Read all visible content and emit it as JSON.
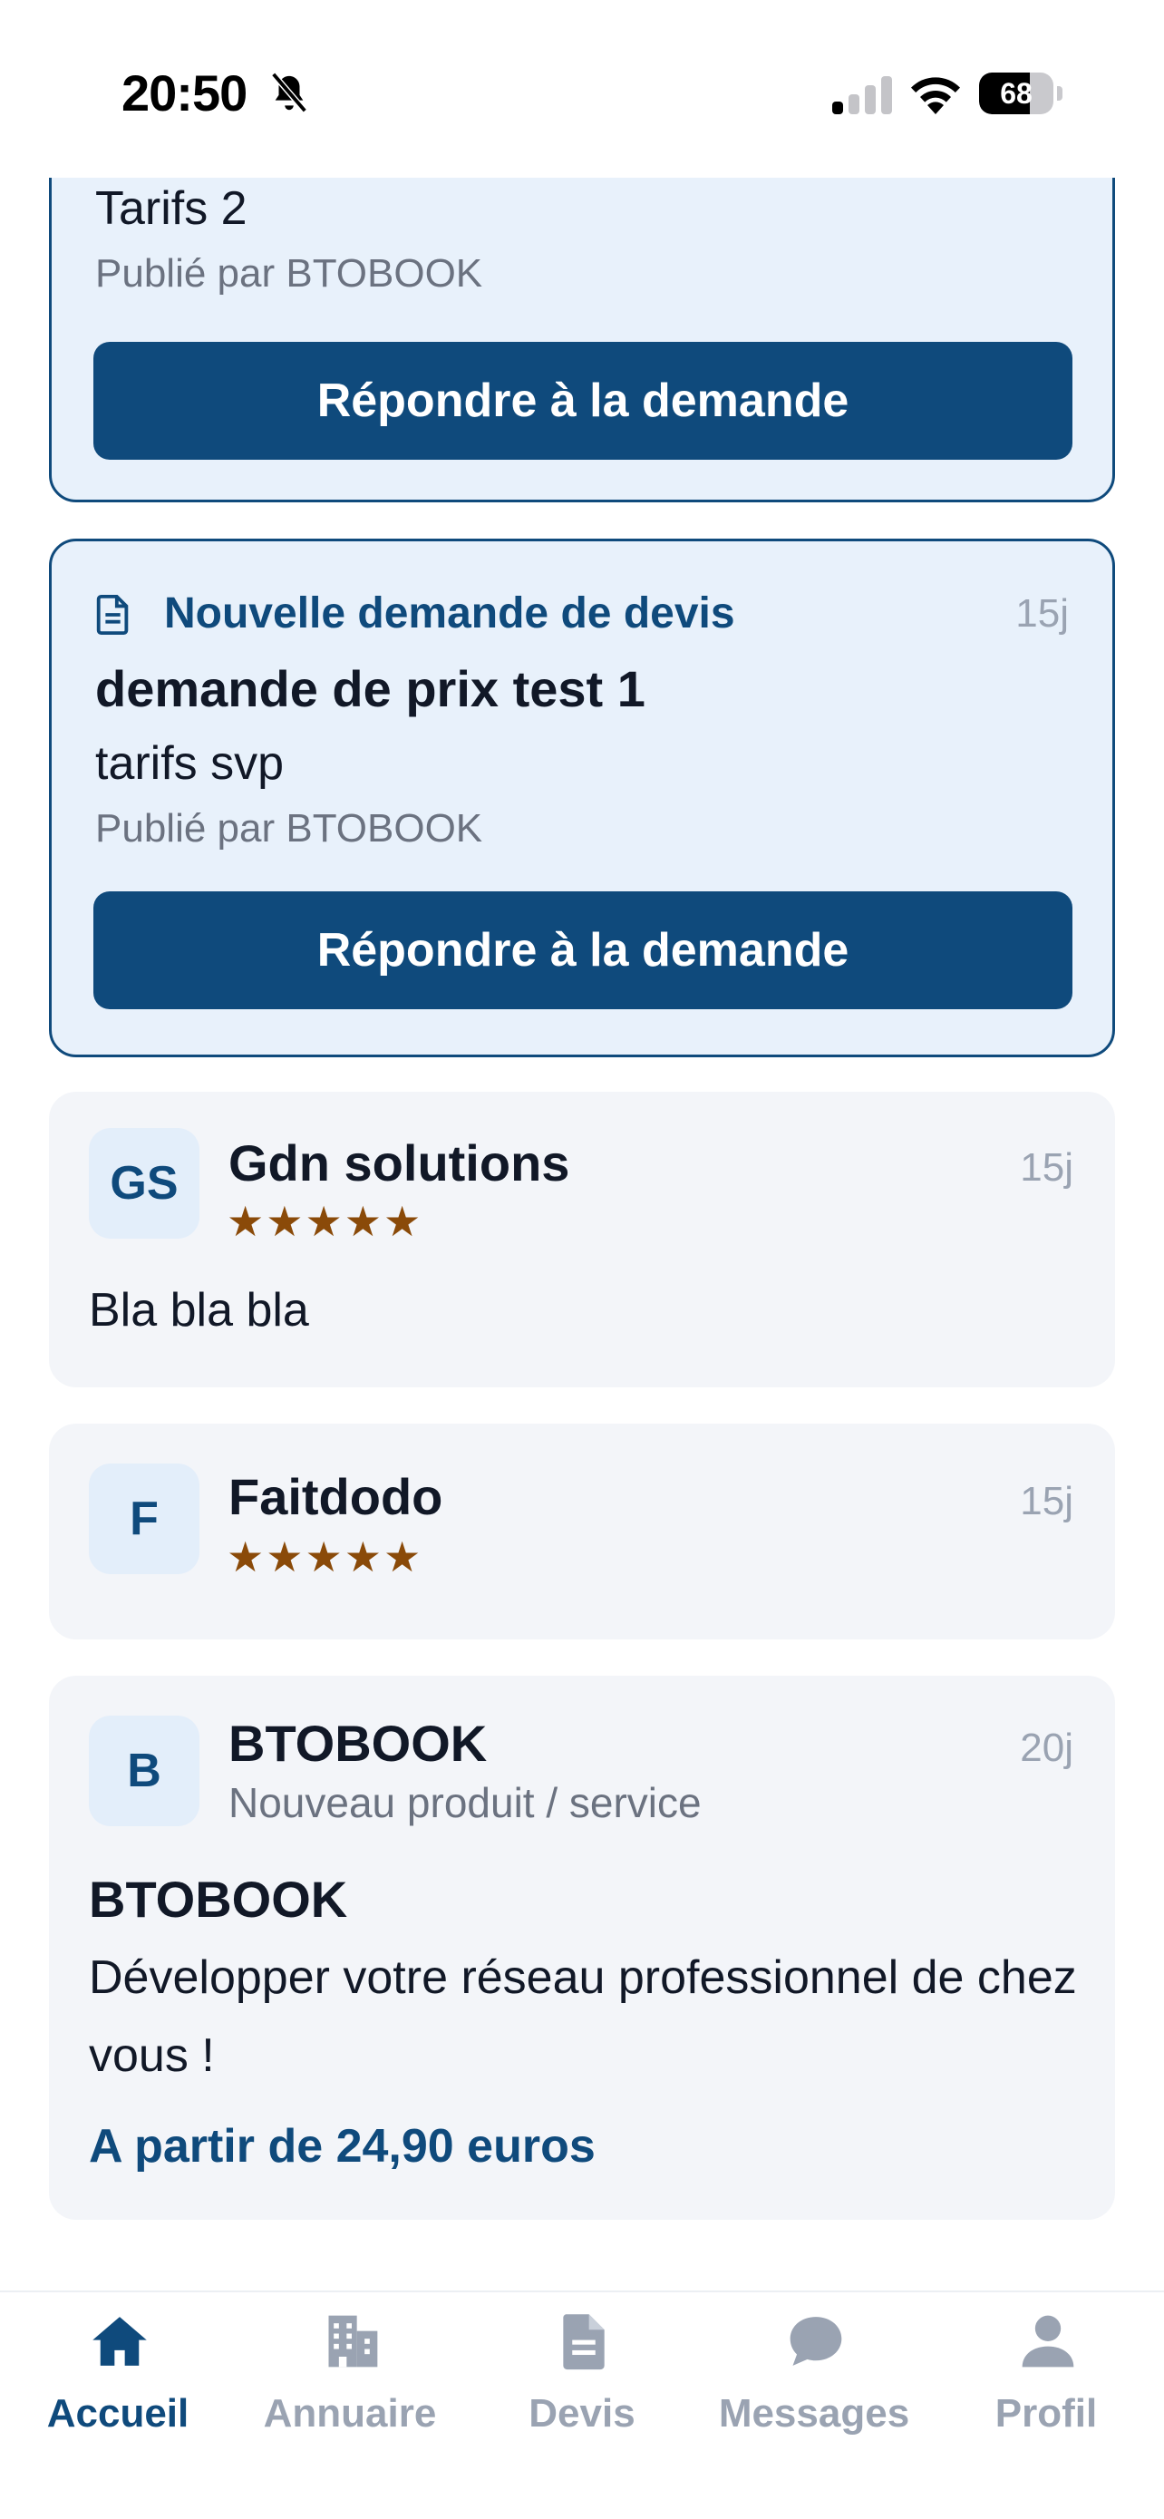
{
  "status_bar": {
    "time": "20:50",
    "battery": "68",
    "battery_level": 0.68
  },
  "cards": [
    {
      "kind": "request",
      "body": "Tarifs 2",
      "author": "Publié par BTOBOOK",
      "button": "Répondre à la demande"
    },
    {
      "kind": "request",
      "type_label": "Nouvelle demande de devis",
      "age": "15j",
      "title": "demande de prix test 1",
      "body": "tarifs svp",
      "author": "Publié par BTOBOOK",
      "button": "Répondre à la demande"
    },
    {
      "kind": "review",
      "initials": "GS",
      "name": "Gdn solutions",
      "rating": 5,
      "stars": "★★★★★",
      "age": "15j",
      "text": "Bla bla bla"
    },
    {
      "kind": "review",
      "initials": "F",
      "name": "Faitdodo",
      "rating": 5,
      "stars": "★★★★★",
      "age": "15j"
    },
    {
      "kind": "post",
      "initials": "B",
      "name": "BTOBOOK",
      "subtitle": "Nouveau produit / service",
      "age": "20j",
      "title": "BTOBOOK",
      "description": "Développer votre réseau professionnel de chez vous !",
      "price": "A partir de 24,90 euros"
    }
  ],
  "tabs": [
    {
      "label": "Accueil",
      "icon": "home-icon",
      "active": true
    },
    {
      "label": "Annuaire",
      "icon": "building-icon",
      "active": false
    },
    {
      "label": "Devis",
      "icon": "document-icon",
      "active": false
    },
    {
      "label": "Messages",
      "icon": "chat-bubble-icon",
      "active": false
    },
    {
      "label": "Profil",
      "icon": "user-icon",
      "active": false
    }
  ],
  "colors": {
    "primary": "#0f4a7c",
    "request_background": "#e8f1fb",
    "card_background": "#f3f5f9",
    "star": "#8a4a09",
    "muted": "#9aa3b2"
  }
}
